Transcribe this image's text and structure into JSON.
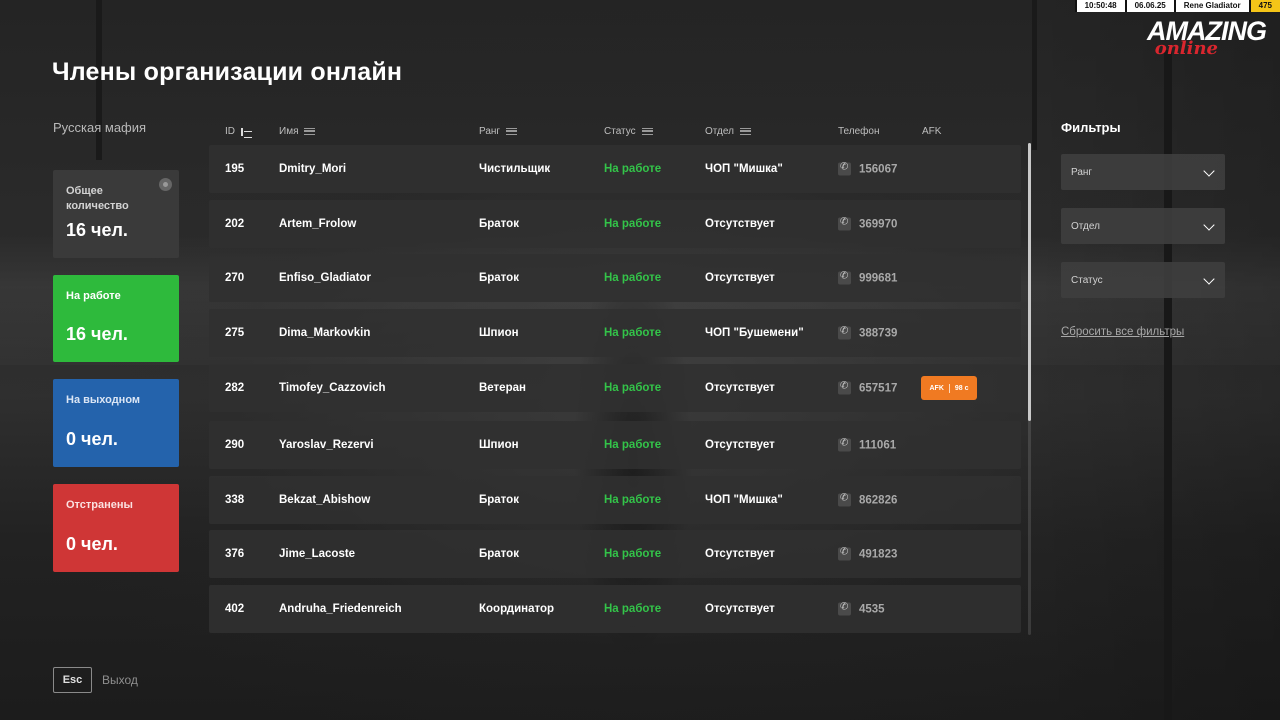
{
  "hud": {
    "time": "10:50:48",
    "date": "06.06.25",
    "player": "Rene Gladiator",
    "level": "475"
  },
  "logo": {
    "main": "AMAZING",
    "sub": "online"
  },
  "title": "Члены организации онлайн",
  "organization": "Русская мафия",
  "stats": {
    "total": {
      "label": "Общее количество",
      "value": "16 чел."
    },
    "working": {
      "label": "На работе",
      "value": "16 чел."
    },
    "off": {
      "label": "На выходном",
      "value": "0 чел."
    },
    "banned": {
      "label": "Отстранены",
      "value": "0 чел."
    }
  },
  "columns": {
    "id": "ID",
    "name": "Имя",
    "rank": "Ранг",
    "status": "Статус",
    "dept": "Отдел",
    "phone": "Телефон",
    "afk": "AFK"
  },
  "members": [
    {
      "id": "195",
      "name": "Dmitry_Mori",
      "rank": "Чистильщик",
      "status": "На работе",
      "dept": "ЧОП \"Мишка\"",
      "phone": "156067"
    },
    {
      "id": "202",
      "name": "Artem_Frolow",
      "rank": "Браток",
      "status": "На работе",
      "dept": "Отсутствует",
      "phone": "369970"
    },
    {
      "id": "270",
      "name": "Enfiso_Gladiator",
      "rank": "Браток",
      "status": "На работе",
      "dept": "Отсутствует",
      "phone": "999681"
    },
    {
      "id": "275",
      "name": "Dima_Markovkin",
      "rank": "Шпион",
      "status": "На работе",
      "dept": "ЧОП \"Бушемени\"",
      "phone": "388739"
    },
    {
      "id": "282",
      "name": "Timofey_Cazzovich",
      "rank": "Ветеран",
      "status": "На работе",
      "dept": "Отсутствует",
      "phone": "657517",
      "afk_label": "AFK",
      "afk_time": "98 с"
    },
    {
      "id": "290",
      "name": "Yaroslav_Rezervi",
      "rank": "Шпион",
      "status": "На работе",
      "dept": "Отсутствует",
      "phone": "111061"
    },
    {
      "id": "338",
      "name": "Bekzat_Abishow",
      "rank": "Браток",
      "status": "На работе",
      "dept": "ЧОП \"Мишка\"",
      "phone": "862826"
    },
    {
      "id": "376",
      "name": "Jime_Lacoste",
      "rank": "Браток",
      "status": "На работе",
      "dept": "Отсутствует",
      "phone": "491823"
    },
    {
      "id": "402",
      "name": "Andruha_Friedenreich",
      "rank": "Координатор",
      "status": "На работе",
      "dept": "Отсутствует",
      "phone": "4535"
    }
  ],
  "filters": {
    "title": "Фильтры",
    "rank": "Ранг",
    "dept": "Отдел",
    "status": "Статус",
    "reset": "Сбросить все фильтры"
  },
  "footer": {
    "key": "Esc",
    "label": "Выход"
  },
  "colors": {
    "working": "#2eba3c",
    "off": "#2463ac",
    "banned": "#cf3636",
    "afk": "#f07a22",
    "status_text": "#33c449"
  }
}
